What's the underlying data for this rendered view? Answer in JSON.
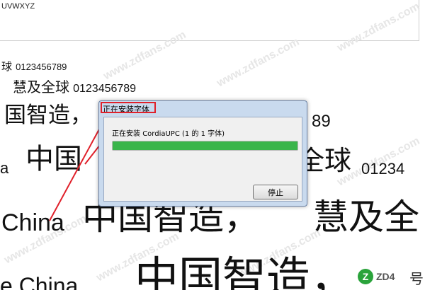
{
  "preview": {
    "alphabet_tail": "UVWXYZ",
    "lines": [
      {
        "cjk": "球",
        "latin": "0123456789"
      },
      {
        "cjk": "慧及全球",
        "latin": "0123456789"
      },
      {
        "cjk": "国智造，",
        "latin": "89"
      },
      {
        "cjk_left": "中国",
        "latin_left": "a",
        "cjk_right": "全球",
        "latin_right": "01234"
      },
      {
        "latin": "China",
        "cjk": "中国智造，",
        "cjk_right": "慧及全"
      },
      {
        "latin": "e China",
        "cjk": "中国智造，"
      }
    ]
  },
  "dialog": {
    "title": "正在安装字体",
    "status_prefix": "正在安装",
    "font_name": "CordiaUPC",
    "status_suffix": "(1 的 1 字体)",
    "progress_fraction": 1.0,
    "stop_button": "停止"
  },
  "watermark": {
    "text": "www.zdfans.com"
  },
  "logo": {
    "mark": "Z",
    "text": "ZD4",
    "cjk": "号"
  },
  "colors": {
    "highlight": "#e0202a",
    "progress": "#39b54a",
    "dialog_frame": "#c9daee"
  }
}
